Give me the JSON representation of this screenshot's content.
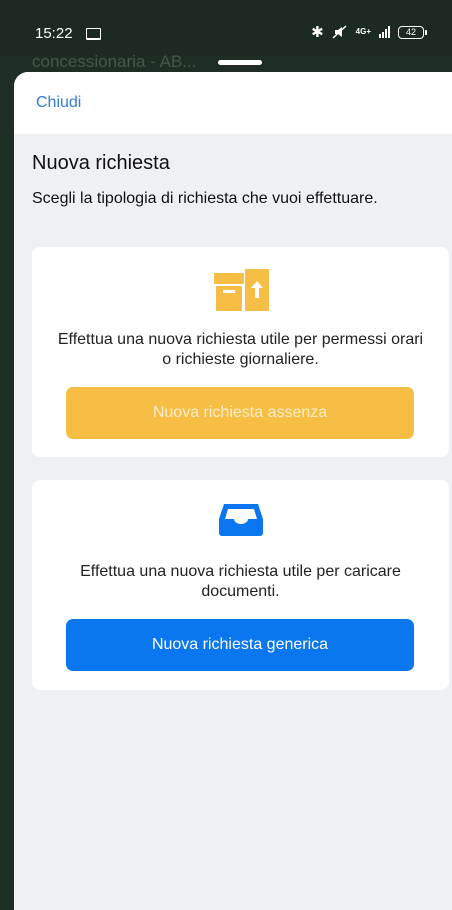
{
  "status_bar": {
    "time": "15:22",
    "network": "4G+",
    "battery": "42",
    "bluetooth_icon": "bluetooth-icon",
    "mute_icon": "mute-icon"
  },
  "background": {
    "title": "concessionaria - AB..."
  },
  "sheet": {
    "close_label": "Chiudi",
    "title": "Nuova richiesta",
    "subtitle": "Scegli la tipologia di richiesta che vuoi effettuare."
  },
  "cards": [
    {
      "icon": "archive-upload-icon",
      "description": "Effettua una nuova richiesta utile per permessi orari o richieste giornaliere.",
      "button_label": "Nuova richiesta assenza",
      "color": "#f7be45"
    },
    {
      "icon": "inbox-tray-icon",
      "description": "Effettua una nuova richiesta utile per caricare documenti.",
      "button_label": "Nuova richiesta generica",
      "color": "#0a76ef"
    }
  ],
  "colors": {
    "accent_link": "#2f7fd4",
    "sheet_background": "#eef0f3"
  }
}
